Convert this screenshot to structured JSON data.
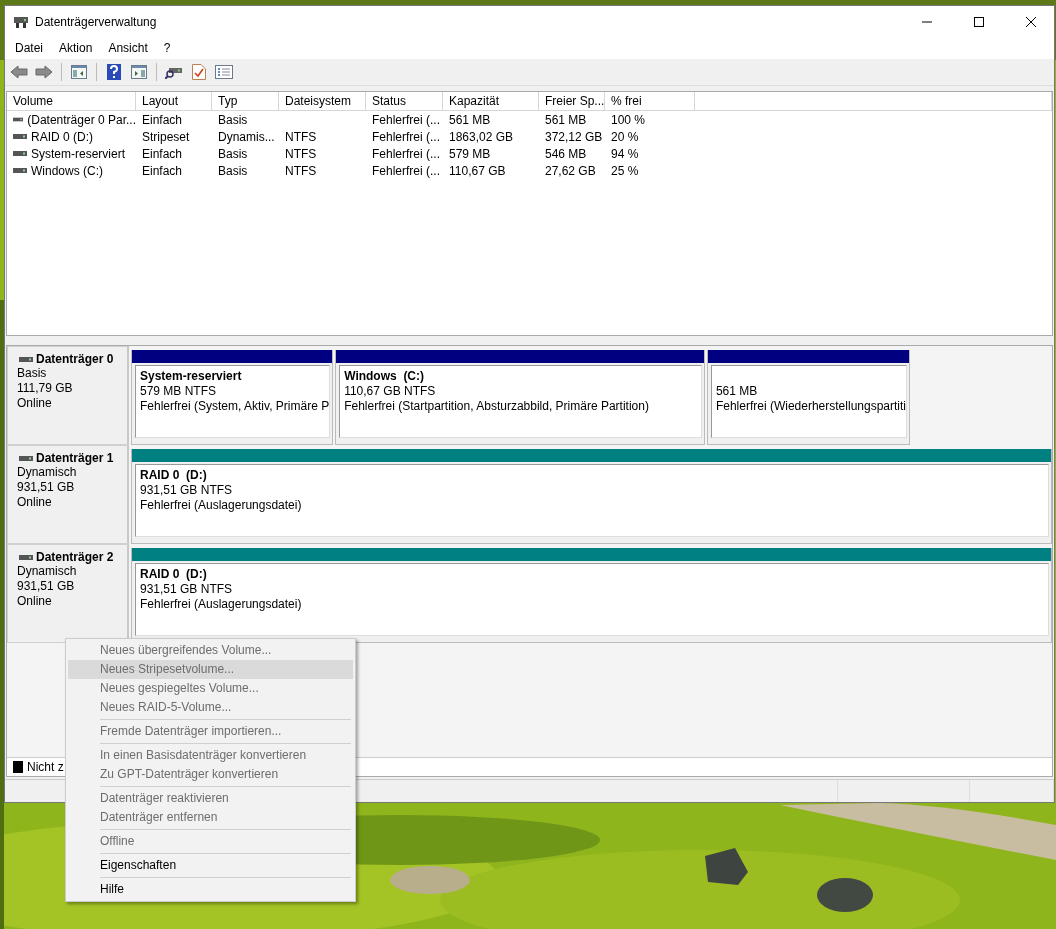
{
  "window": {
    "title": "Datenträgerverwaltung"
  },
  "menu_bar": [
    "Datei",
    "Aktion",
    "Ansicht",
    "?"
  ],
  "volume_table": {
    "columns": [
      "Volume",
      "Layout",
      "Typ",
      "Dateisystem",
      "Status",
      "Kapazität",
      "Freier Sp...",
      "% frei"
    ],
    "rows": [
      {
        "cells": [
          "(Datenträger 0 Par...",
          "Einfach",
          "Basis",
          "",
          "Fehlerfrei (...",
          "561 MB",
          "561 MB",
          "100 %"
        ]
      },
      {
        "cells": [
          "RAID 0 (D:)",
          "Stripeset",
          "Dynamis...",
          "NTFS",
          "Fehlerfrei (...",
          "1863,02 GB",
          "372,12 GB",
          "20 %"
        ]
      },
      {
        "cells": [
          "System-reserviert",
          "Einfach",
          "Basis",
          "NTFS",
          "Fehlerfrei (...",
          "579 MB",
          "546 MB",
          "94 %"
        ]
      },
      {
        "cells": [
          "Windows (C:)",
          "Einfach",
          "Basis",
          "NTFS",
          "Fehlerfrei (...",
          "110,67 GB",
          "27,62 GB",
          "25 %"
        ]
      }
    ]
  },
  "disks": [
    {
      "name": "Datenträger 0",
      "type": "Basis",
      "size": "111,79 GB",
      "status": "Online",
      "partitions": [
        {
          "color": "#000080",
          "title": "System-reserviert",
          "size": "579 MB NTFS",
          "status": "Fehlerfrei (System, Aktiv, Primäre P"
        },
        {
          "color": "#000080",
          "title": "Windows  (C:)",
          "size": "110,67 GB NTFS",
          "status": "Fehlerfrei (Startpartition, Absturzabbild, Primäre Partition)"
        },
        {
          "color": "#000080",
          "size": "561 MB",
          "status": "Fehlerfrei (Wiederherstellungspartiti"
        }
      ]
    },
    {
      "name": "Datenträger 1",
      "type": "Dynamisch",
      "size": "931,51 GB",
      "status": "Online",
      "partitions": [
        {
          "color": "#008080",
          "title": "RAID 0  (D:)",
          "size": "931,51 GB NTFS",
          "status": "Fehlerfrei (Auslagerungsdatei)"
        }
      ]
    },
    {
      "name": "Datenträger 2",
      "type": "Dynamisch",
      "size": "931,51 GB",
      "status": "Online",
      "partitions": [
        {
          "color": "#008080",
          "title": "RAID 0  (D:)",
          "size": "931,51 GB NTFS",
          "status": "Fehlerfrei (Auslagerungsdatei)"
        }
      ]
    }
  ],
  "legend": [
    {
      "color": "#000000",
      "label": "Nicht z"
    }
  ],
  "context_menu": {
    "groups": [
      [
        {
          "label": "Neues übergreifendes Volume...",
          "disabled": true,
          "selected": false
        },
        {
          "label": "Neues Stripesetvolume...",
          "disabled": true,
          "selected": true
        },
        {
          "label": "Neues gespiegeltes Volume...",
          "disabled": true,
          "selected": false
        },
        {
          "label": "Neues RAID-5-Volume...",
          "disabled": true,
          "selected": false
        }
      ],
      [
        {
          "label": "Fremde Datenträger importieren...",
          "disabled": true,
          "selected": false
        }
      ],
      [
        {
          "label": "In einen Basisdatenträger konvertieren",
          "disabled": true,
          "selected": false
        },
        {
          "label": "Zu GPT-Datenträger konvertieren",
          "disabled": true,
          "selected": false
        }
      ],
      [
        {
          "label": "Datenträger reaktivieren",
          "disabled": true,
          "selected": false
        },
        {
          "label": "Datenträger entfernen",
          "disabled": true,
          "selected": false
        }
      ],
      [
        {
          "label": "Offline",
          "disabled": true,
          "selected": false
        }
      ],
      [
        {
          "label": "Eigenschaften",
          "disabled": false,
          "selected": false
        }
      ],
      [
        {
          "label": "Hilfe",
          "disabled": false,
          "selected": false
        }
      ]
    ]
  }
}
